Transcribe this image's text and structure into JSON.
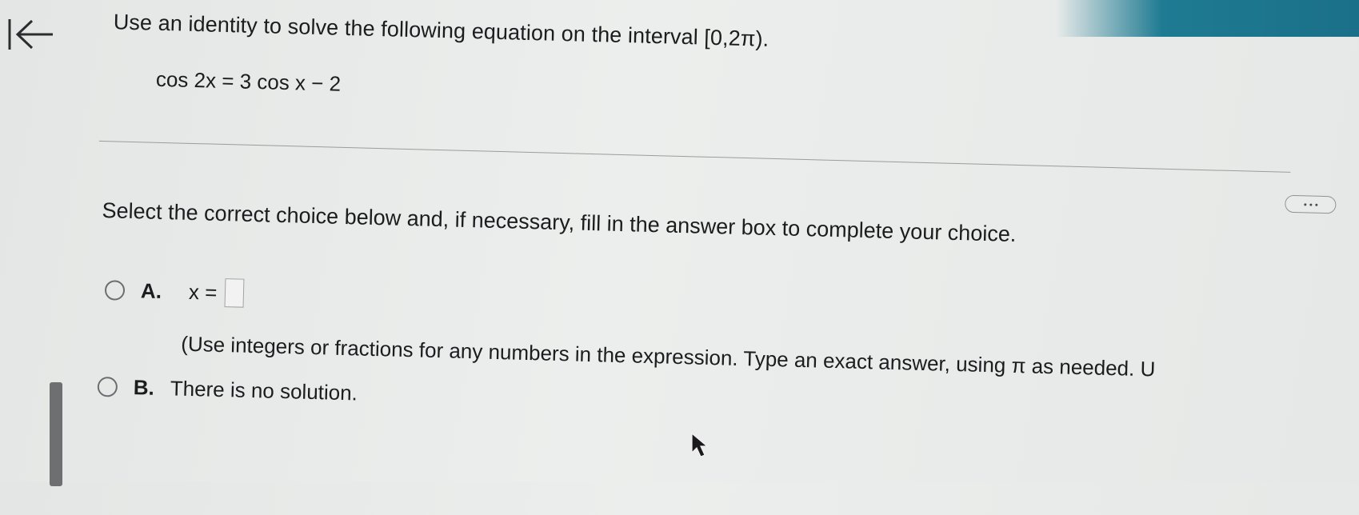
{
  "question": {
    "prompt": "Use an identity to solve the following equation on the interval [0,2π).",
    "equation": "cos 2x = 3 cos x − 2"
  },
  "instruction": "Select the correct choice below and, if necessary, fill in the answer box to complete your choice.",
  "choices": {
    "a": {
      "letter": "A.",
      "expression": "x =",
      "answer_value": "",
      "hint": "(Use integers or fractions for any numbers in the expression. Type an exact answer, using π as needed. U"
    },
    "b": {
      "letter": "B.",
      "text": "There is no solution."
    }
  },
  "icons": {
    "back": "back-to-start-icon",
    "more": "more-options-icon",
    "cursor": "mouse-pointer-icon"
  },
  "colors": {
    "top_band": "#1e7b92",
    "text": "#1c1c1e",
    "background": "#e9ebea"
  }
}
